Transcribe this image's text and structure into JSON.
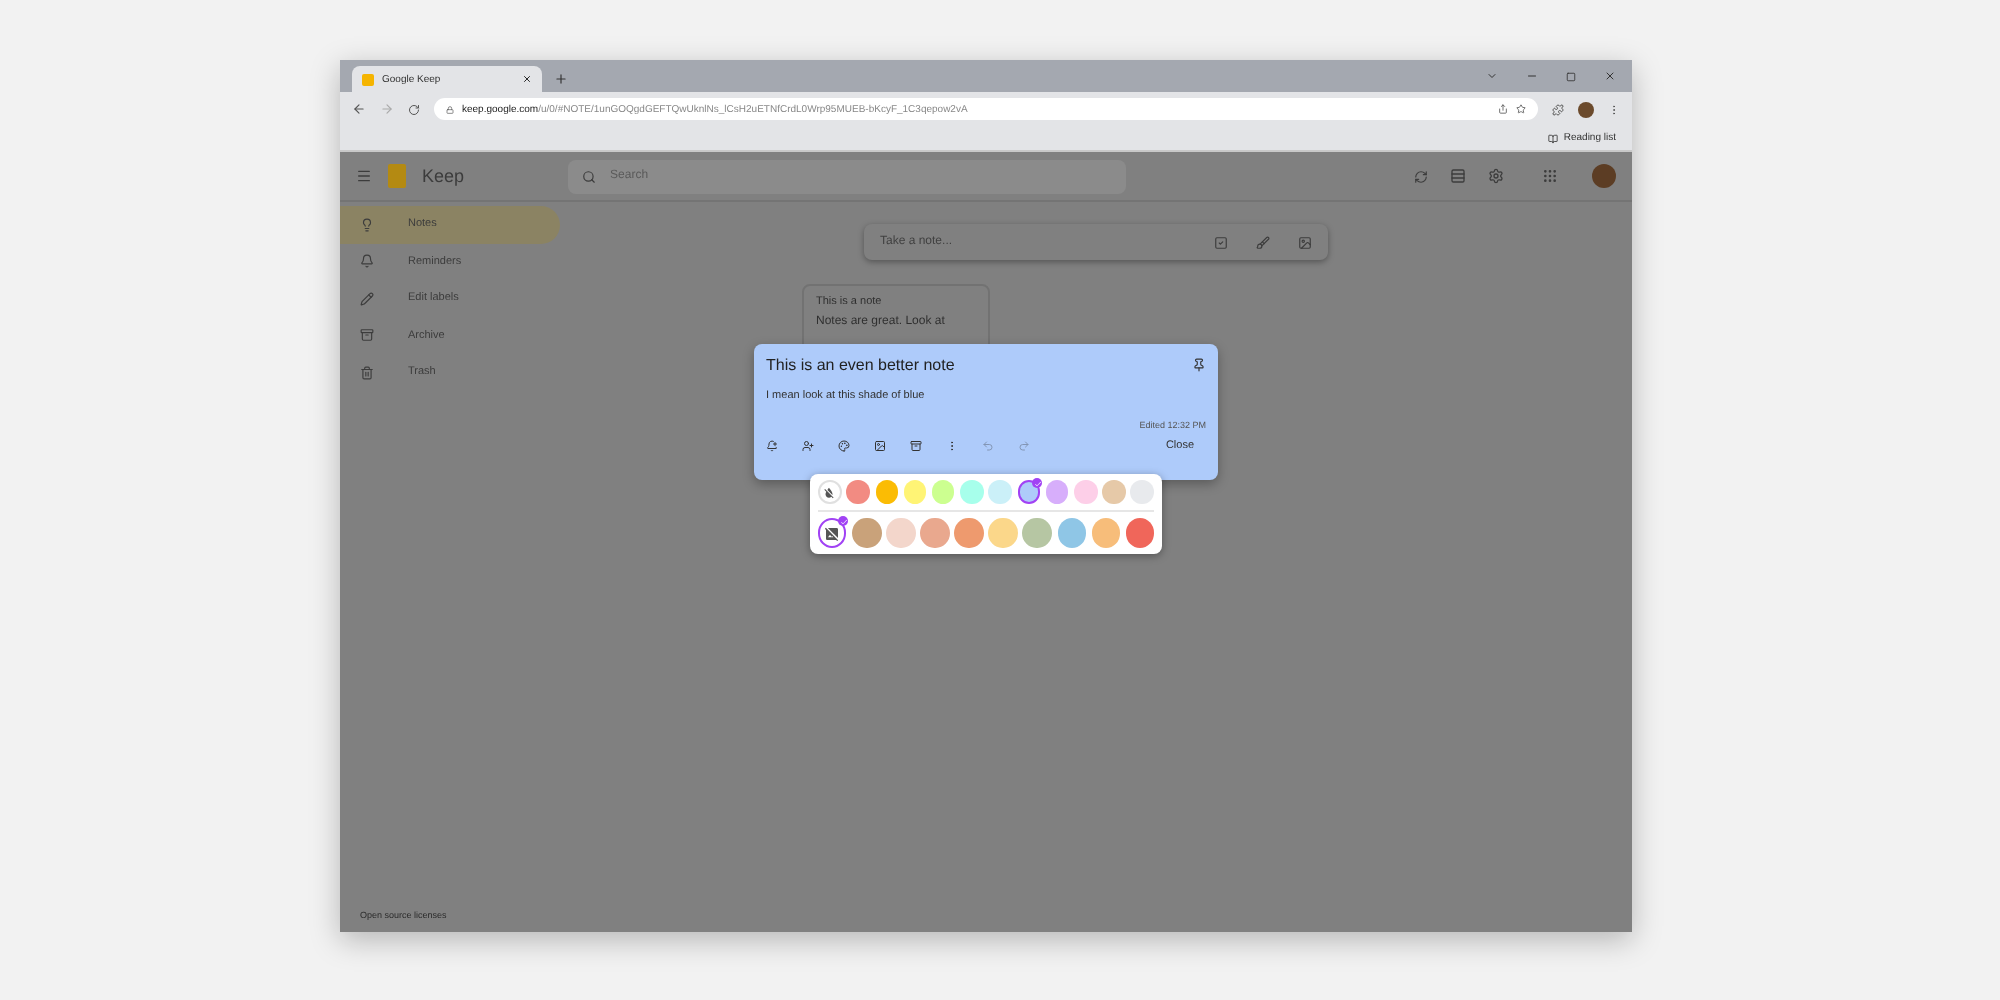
{
  "browser": {
    "tab_title": "Google Keep",
    "url_host": "keep.google.com",
    "url_path": "/u/0/#NOTE/1unGOQgdGEFTQwUknlNs_lCsH2uETNfCrdL0Wrp95MUEB-bKcyF_1C3qepow2vA",
    "reading_list": "Reading list"
  },
  "app": {
    "name": "Keep",
    "search": {
      "placeholder": "Search"
    }
  },
  "sidebar": {
    "items": [
      {
        "kind": "notes",
        "label": "Notes",
        "selected": true
      },
      {
        "kind": "reminders",
        "label": "Reminders",
        "selected": false
      },
      {
        "kind": "labels",
        "label": "Edit labels",
        "selected": false
      },
      {
        "kind": "archive",
        "label": "Archive",
        "selected": false
      },
      {
        "kind": "trash",
        "label": "Trash",
        "selected": false
      }
    ],
    "footer": "Open source licenses"
  },
  "take_note": {
    "placeholder": "Take a note..."
  },
  "notes": [
    {
      "title": "This is a note",
      "body": "Notes are great. Look at"
    }
  ],
  "open_note": {
    "title": "This is an even better note",
    "body": "I mean look at this shade of blue",
    "edited": "Edited 12:32 PM",
    "close": "Close",
    "toolbar": [
      {
        "kind": "remind",
        "disabled": false
      },
      {
        "kind": "collaborator",
        "disabled": false
      },
      {
        "kind": "palette",
        "disabled": false
      },
      {
        "kind": "image",
        "disabled": false
      },
      {
        "kind": "archive",
        "disabled": false
      },
      {
        "kind": "more",
        "disabled": false
      },
      {
        "kind": "undo",
        "disabled": true
      },
      {
        "kind": "redo",
        "disabled": true
      }
    ]
  },
  "palette": {
    "colors": [
      {
        "kind": "none",
        "selected": false
      },
      {
        "kind": "color",
        "color": "#f28b82",
        "selected": false
      },
      {
        "kind": "color",
        "color": "#fbbc04",
        "selected": false
      },
      {
        "kind": "color",
        "color": "#fff475",
        "selected": false
      },
      {
        "kind": "color",
        "color": "#ccff90",
        "selected": false
      },
      {
        "kind": "color",
        "color": "#a7ffeb",
        "selected": false
      },
      {
        "kind": "color",
        "color": "#cbf0f8",
        "selected": false
      },
      {
        "kind": "color",
        "color": "#aecbfa",
        "selected": true
      },
      {
        "kind": "color",
        "color": "#d7aefb",
        "selected": false
      },
      {
        "kind": "color",
        "color": "#fdcfe8",
        "selected": false
      },
      {
        "kind": "color",
        "color": "#e6c9a8",
        "selected": false
      },
      {
        "kind": "color",
        "color": "#e8eaed",
        "selected": false
      }
    ],
    "backgrounds": [
      {
        "kind": "none",
        "selected": true
      },
      {
        "kind": "pattern",
        "color": "#c9a27a",
        "selected": false
      },
      {
        "kind": "pattern",
        "color": "#f3d6cb",
        "selected": false
      },
      {
        "kind": "pattern",
        "color": "#e9a88e",
        "selected": false
      },
      {
        "kind": "pattern",
        "color": "#ee9a6e",
        "selected": false
      },
      {
        "kind": "pattern",
        "color": "#fbd78a",
        "selected": false
      },
      {
        "kind": "pattern",
        "color": "#b6c6a3",
        "selected": false
      },
      {
        "kind": "pattern",
        "color": "#8fc6e6",
        "selected": false
      },
      {
        "kind": "pattern",
        "color": "#f7bd7a",
        "selected": false
      },
      {
        "kind": "pattern",
        "color": "#f0665a",
        "selected": false
      }
    ]
  }
}
